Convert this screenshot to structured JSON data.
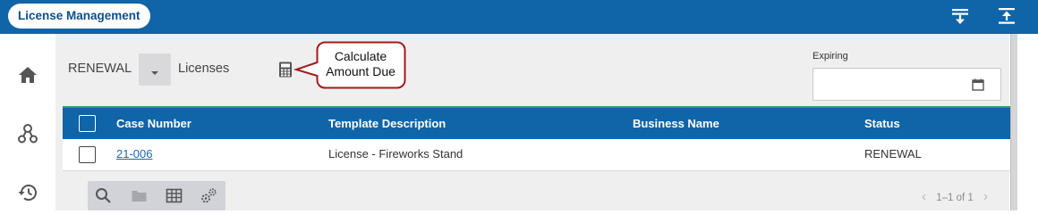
{
  "app": {
    "title": "License Management"
  },
  "header": {
    "icons": [
      "collapse-all-icon",
      "expand-all-icon"
    ]
  },
  "sidebar": {
    "items": [
      {
        "icon": "home-icon"
      },
      {
        "icon": "people-icon"
      },
      {
        "icon": "history-icon"
      }
    ]
  },
  "filters": {
    "status_value": "RENEWAL",
    "type_label": "Licenses",
    "calculator_icon": "calculator-icon",
    "callout_lines": [
      "Calculate",
      "Amount Due"
    ],
    "expiring_label": "Expiring",
    "expiring_value": ""
  },
  "table": {
    "columns": [
      "Case Number",
      "Template Description",
      "Business Name",
      "Status"
    ],
    "rows": [
      {
        "case_number": "21-006",
        "template_description": "License - Fireworks Stand",
        "business_name": "",
        "status": "RENEWAL"
      }
    ]
  },
  "toolbar": {
    "icons": [
      "search-icon",
      "folder-icon",
      "table-view-icon",
      "settings-icon"
    ]
  },
  "pager": {
    "text": "1–1 of 1"
  },
  "colors": {
    "brand": "#0f65a8",
    "accent": "#2e9e5e",
    "callout_border": "#a31919",
    "link": "#1a66b3"
  }
}
